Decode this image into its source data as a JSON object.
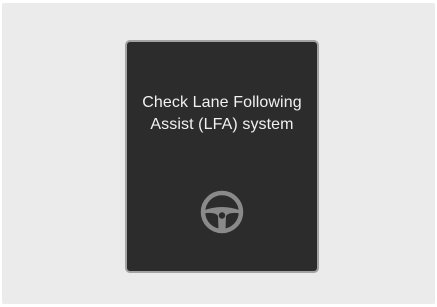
{
  "warning": {
    "line1": "Check Lane Following",
    "line2": "Assist (LFA) system",
    "icon": "steering-wheel-icon",
    "icon_color": "#8a8a8a",
    "text_color": "#f1f1f1",
    "screen_color": "#2c2c2c"
  }
}
